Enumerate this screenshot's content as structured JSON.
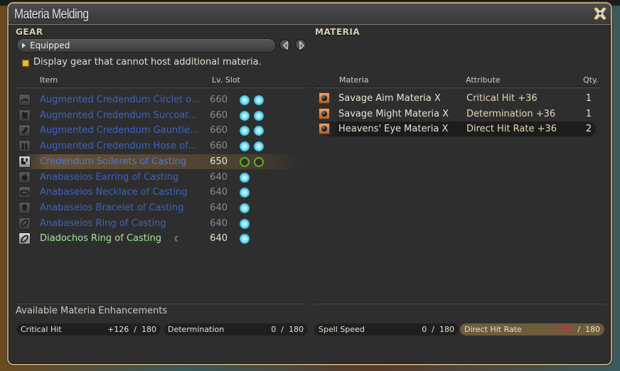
{
  "window": {
    "title": "Materia Melding"
  },
  "gear": {
    "section_label": "GEAR",
    "filter_dropdown": "Equipped",
    "checkbox_label": "Display gear that cannot host additional materia.",
    "checkbox_checked": true,
    "columns": {
      "item": "Item",
      "lv_slot": "Lv. Slot"
    },
    "items": [
      {
        "icon": "head-gear-icon",
        "name": "Augmented Credendum Circlet o...",
        "lv": "660",
        "slots": [
          "filled",
          "filled"
        ],
        "style": "blue"
      },
      {
        "icon": "body-gear-icon",
        "name": "Augmented Credendum Surcoat...",
        "lv": "660",
        "slots": [
          "filled",
          "filled"
        ],
        "style": "blue"
      },
      {
        "icon": "hands-gear-icon",
        "name": "Augmented Credendum Gauntle...",
        "lv": "660",
        "slots": [
          "filled",
          "filled"
        ],
        "style": "blue"
      },
      {
        "icon": "legs-gear-icon",
        "name": "Augmented Credendum Hose of...",
        "lv": "660",
        "slots": [
          "filled",
          "filled"
        ],
        "style": "blue"
      },
      {
        "icon": "feet-gear-icon",
        "name": "Credendum Sollerets of Casting",
        "lv": "650",
        "slots": [
          "empty",
          "empty"
        ],
        "style": "selected"
      },
      {
        "icon": "earring-gear-icon",
        "name": "Anabaseios Earring of Casting",
        "lv": "640",
        "slots": [
          "filled"
        ],
        "style": "blue"
      },
      {
        "icon": "necklace-gear-icon",
        "name": "Anabaseios Necklace of Casting",
        "lv": "640",
        "slots": [
          "filled"
        ],
        "style": "blue"
      },
      {
        "icon": "bracelet-gear-icon",
        "name": "Anabaseios Bracelet of Casting",
        "lv": "640",
        "slots": [
          "filled"
        ],
        "style": "blue"
      },
      {
        "icon": "ring-gear-icon",
        "name": "Anabaseios Ring of Casting",
        "lv": "640",
        "slots": [
          "filled"
        ],
        "style": "blue"
      },
      {
        "icon": "ring-gear-icon",
        "name": "Diadochos Ring of Casting",
        "lv": "640",
        "slots": [
          "filled"
        ],
        "style": "green",
        "hq": true
      }
    ]
  },
  "materia": {
    "section_label": "MATERIA",
    "columns": {
      "materia": "Materia",
      "attribute": "Attribute",
      "qty": "Qty."
    },
    "items": [
      {
        "name": "Savage Aim Materia X",
        "attribute": "Critical Hit +36",
        "qty": "1"
      },
      {
        "name": "Savage Might Materia X",
        "attribute": "Determination +36",
        "qty": "1"
      },
      {
        "name": "Heavens' Eye Materia X",
        "attribute": "Direct Hit Rate +36",
        "qty": "2",
        "selected": true
      }
    ]
  },
  "enhancements": {
    "title": "Available Materia Enhancements",
    "stats": [
      {
        "name": "Critical Hit",
        "current": "+126",
        "max": "180",
        "capped": false
      },
      {
        "name": "Determination",
        "current": "0",
        "max": "180",
        "capped": false
      },
      {
        "name": "Spell Speed",
        "current": "0",
        "max": "180",
        "capped": false
      },
      {
        "name": "Direct Hit Rate",
        "current": "+180",
        "max": "180",
        "capped": true
      }
    ]
  },
  "colors": {
    "accent_gold": "#b9a57a",
    "gear_name_blue": "#3f63c2",
    "gear_name_hq_green": "#a6e4a0",
    "capped_red": "#d4244a",
    "checkbox_yellow": "#f1b82b",
    "empty_slot_green": "#5fb02a",
    "materia_slot_cyan": "#1aa6bd"
  }
}
